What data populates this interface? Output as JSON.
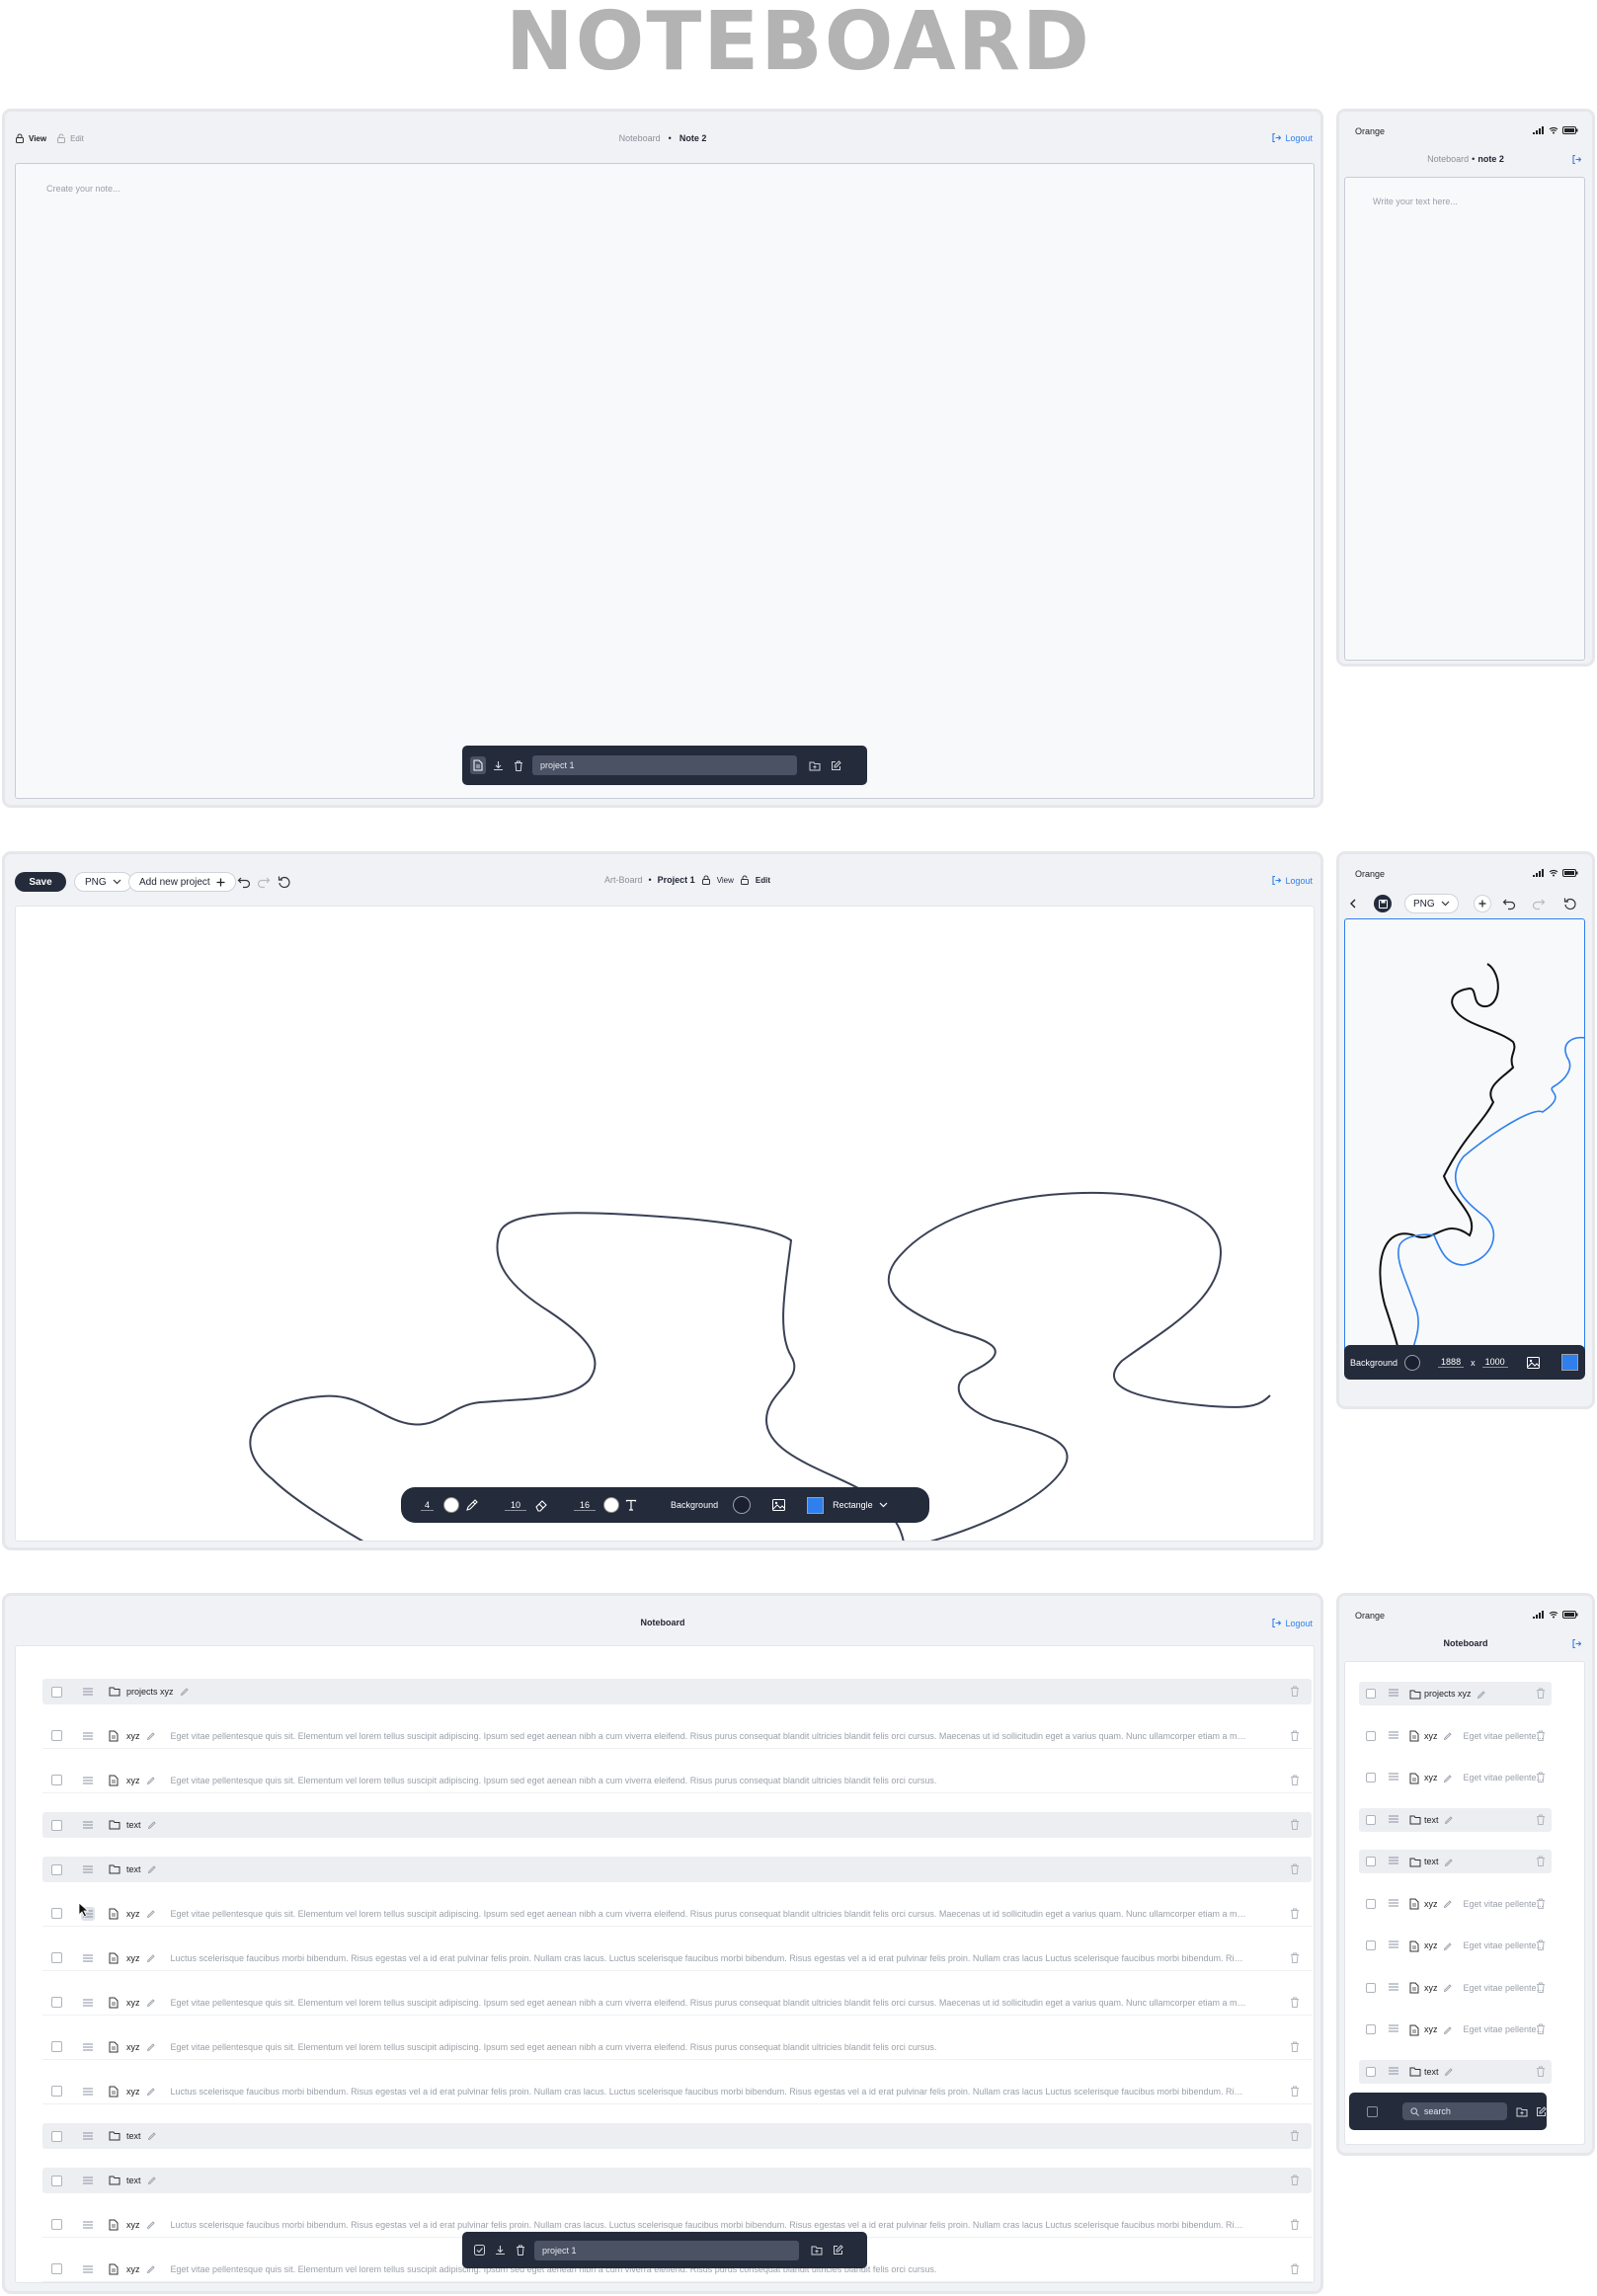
{
  "page_title": "NOTEBOARD",
  "common": {
    "logout_label": "Logout",
    "carrier": "Orange",
    "accent_color": "#2f80ed",
    "dark_bar_color": "#242b3b"
  },
  "note_desktop": {
    "view_label": "View",
    "edit_label": "Edit",
    "breadcrumb_root": "Noteboard",
    "breadcrumb_separator": "•",
    "breadcrumb_current": "Note 2",
    "editor_placeholder": "Create your note...",
    "bottom_bar_project": "project 1"
  },
  "note_mobile": {
    "breadcrumb_root": "Noteboard",
    "breadcrumb_separator": "•",
    "breadcrumb_current": "note 2",
    "editor_placeholder": "Write your text here..."
  },
  "art_desktop": {
    "save_label": "Save",
    "format_label": "PNG",
    "add_project_label": "Add new  project",
    "breadcrumb_root": "Art-Board",
    "breadcrumb_separator": "•",
    "breadcrumb_current": "Project 1",
    "view_label": "View",
    "edit_label": "Edit",
    "toolbar": {
      "brush_size": "4",
      "eraser_size": "10",
      "text_size": "16",
      "background_label": "Background",
      "shape_label": "Rectangle"
    }
  },
  "art_mobile": {
    "format_label": "PNG",
    "background_label": "Background",
    "width": "1888",
    "x_label": "x",
    "height": "1000"
  },
  "list_desktop": {
    "title": "Noteboard",
    "bottom_bar_project": "project 1",
    "rows": [
      {
        "type": "folder",
        "label": "projects xyz",
        "desc": ""
      },
      {
        "type": "note",
        "label": "xyz",
        "desc": "Eget vitae pellentesque quis sit. Elementum vel lorem tellus suscipit adipiscing. Ipsum sed eget aenean nibh a cum viverra eleifend. Risus purus consequat blandit ultricies blandit felis orci cursus. Maecenas ut id sollicitudin eget a varius quam. Nunc ullamcorper etiam a mattis ..."
      },
      {
        "type": "note",
        "label": "xyz",
        "desc": "Eget vitae pellentesque quis sit. Elementum vel lorem tellus suscipit adipiscing. Ipsum sed eget aenean nibh a cum viverra eleifend. Risus purus consequat blandit ultricies blandit felis orci cursus."
      },
      {
        "type": "folder",
        "label": "text",
        "desc": ""
      },
      {
        "type": "folder",
        "label": "text",
        "desc": ""
      },
      {
        "type": "note",
        "label": "xyz",
        "desc": "Eget vitae pellentesque quis sit. Elementum vel lorem tellus suscipit adipiscing. Ipsum sed eget aenean nibh a cum viverra eleifend. Risus purus consequat blandit ultricies blandit felis orci cursus. Maecenas ut id sollicitudin eget a varius quam. Nunc ullamcorper etiam a mattis ..."
      },
      {
        "type": "note",
        "label": "xyz",
        "desc": "Luctus scelerisque faucibus morbi bibendum. Risus egestas vel a id erat pulvinar felis proin. Nullam cras lacus. Luctus scelerisque faucibus morbi bibendum. Risus egestas vel a id erat pulvinar felis proin. Nullam cras lacus Luctus scelerisque faucibus morbi bibendum. Risus ..."
      },
      {
        "type": "note",
        "label": "xyz",
        "desc": "Eget vitae pellentesque quis sit. Elementum vel lorem tellus suscipit adipiscing. Ipsum sed eget aenean nibh a cum viverra eleifend. Risus purus consequat blandit ultricies blandit felis orci cursus. Maecenas ut id sollicitudin eget a varius quam. Nunc ullamcorper etiam a mattis ..."
      },
      {
        "type": "note",
        "label": "xyz",
        "desc": "Eget vitae pellentesque quis sit. Elementum vel lorem tellus suscipit adipiscing. Ipsum sed eget aenean nibh a cum viverra eleifend. Risus purus consequat blandit ultricies blandit felis orci cursus."
      },
      {
        "type": "note",
        "label": "xyz",
        "desc": "Luctus scelerisque faucibus morbi bibendum. Risus egestas vel a id erat pulvinar felis proin. Nullam cras lacus. Luctus scelerisque faucibus morbi bibendum. Risus egestas vel a id erat pulvinar felis proin. Nullam cras lacus Luctus scelerisque faucibus morbi bibendum. Risus ..."
      },
      {
        "type": "folder",
        "label": "text",
        "desc": ""
      },
      {
        "type": "folder",
        "label": "text",
        "desc": ""
      },
      {
        "type": "note",
        "label": "xyz",
        "desc": "Luctus scelerisque faucibus morbi bibendum. Risus egestas vel a id erat pulvinar felis proin. Nullam cras lacus. Luctus scelerisque faucibus morbi bibendum. Risus egestas vel a id erat pulvinar felis proin. Nullam cras lacus Luctus scelerisque faucibus morbi bibendum. Risus ..."
      },
      {
        "type": "note",
        "label": "xyz",
        "desc": "Eget vitae pellentesque quis sit. Elementum vel lorem tellus suscipit adipiscing. Ipsum sed eget aenean nibh a cum viverra eleifend. Risus purus consequat blandit ultricies blandit felis orci cursus."
      }
    ]
  },
  "list_mobile": {
    "title": "Noteboard",
    "search_placeholder": "search",
    "rows": [
      {
        "type": "folder",
        "label": "projects xyz",
        "desc": ""
      },
      {
        "type": "note",
        "label": "xyz",
        "desc": "Eget vitae pellente..."
      },
      {
        "type": "note",
        "label": "xyz",
        "desc": "Eget vitae pellente..."
      },
      {
        "type": "folder",
        "label": "text",
        "desc": ""
      },
      {
        "type": "folder",
        "label": "text",
        "desc": ""
      },
      {
        "type": "note",
        "label": "xyz",
        "desc": "Eget vitae pellente..."
      },
      {
        "type": "note",
        "label": "xyz",
        "desc": "Eget vitae pellente..."
      },
      {
        "type": "note",
        "label": "xyz",
        "desc": "Eget vitae pellente..."
      },
      {
        "type": "note",
        "label": "xyz",
        "desc": "Eget vitae pellente..."
      },
      {
        "type": "folder",
        "label": "text",
        "desc": ""
      }
    ]
  }
}
